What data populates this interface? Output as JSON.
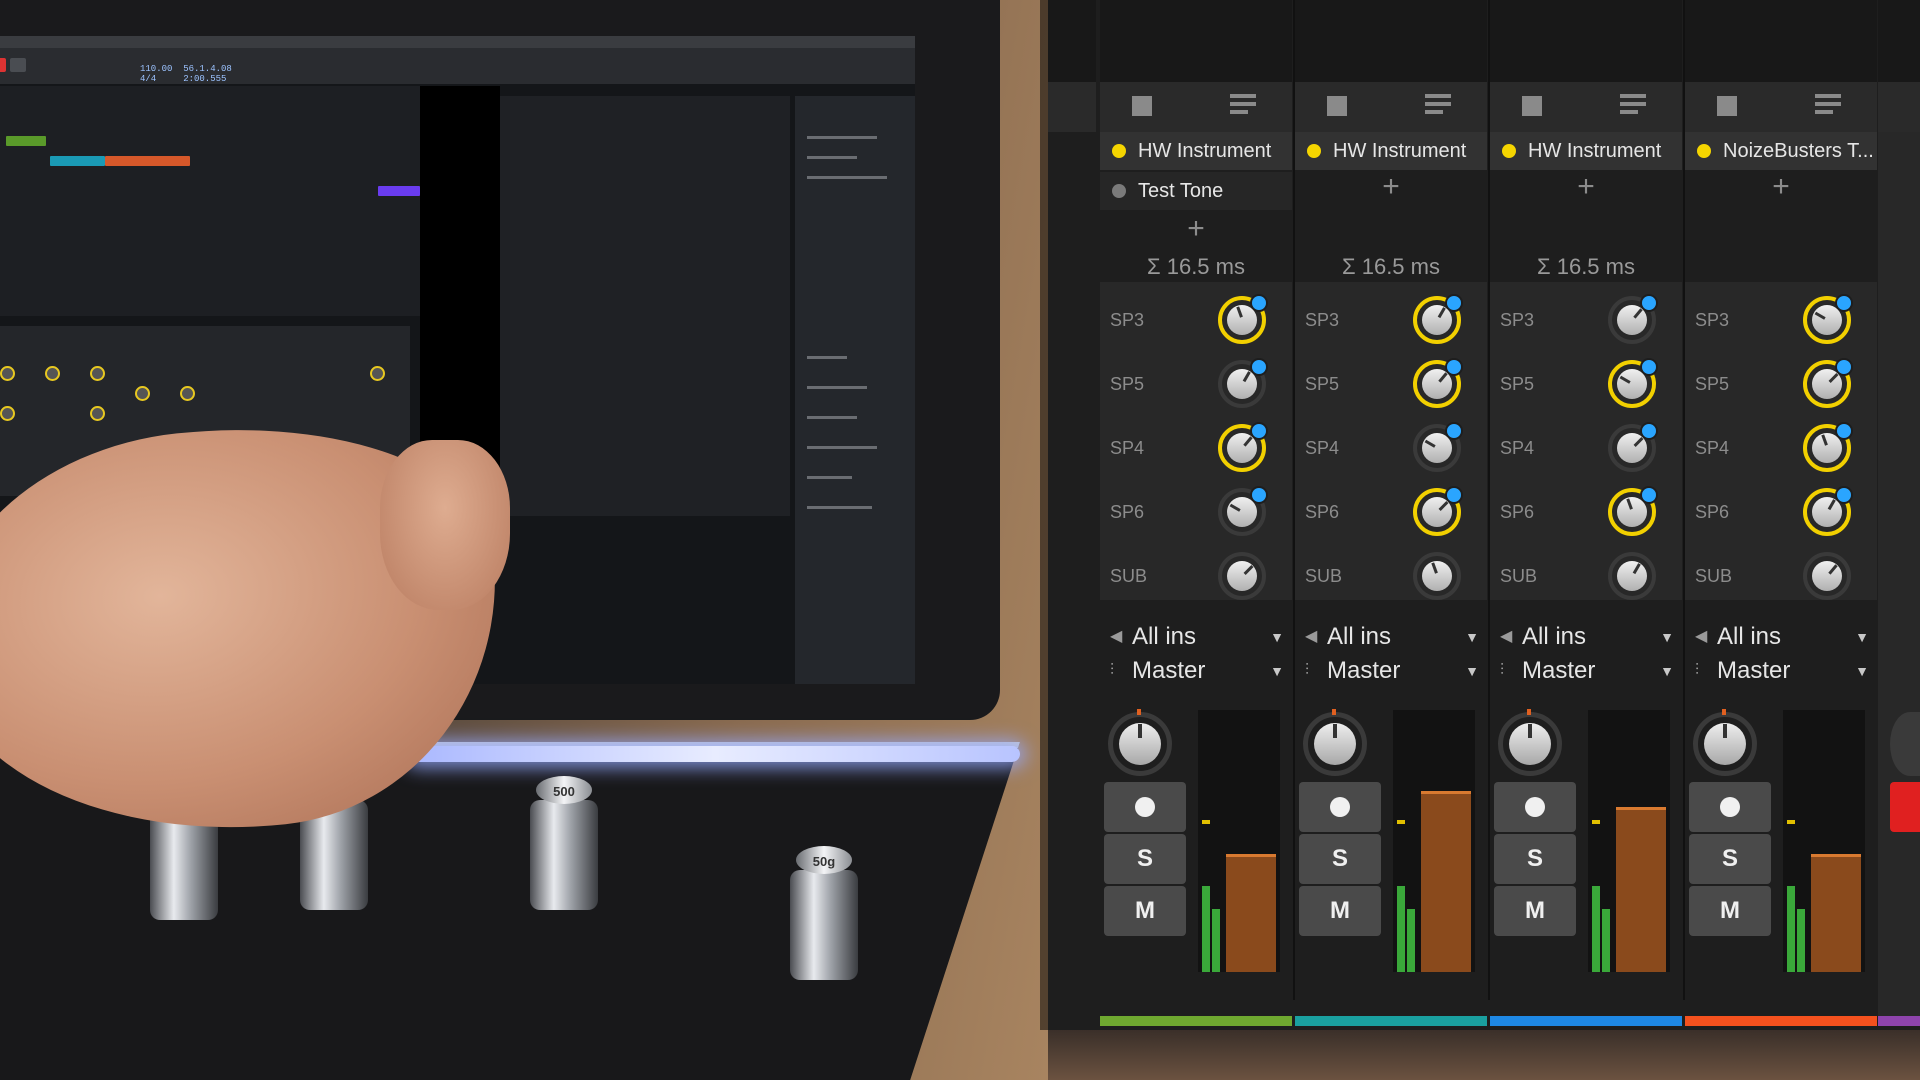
{
  "daw": {
    "clock_text": "110.00  56.1.4.08\n4/4     2:00.555"
  },
  "weights": {
    "left_label": "",
    "mid_label": "500",
    "right_label": "50g"
  },
  "colors": {
    "accent_yellow": "#f5d500",
    "send_dot_blue": "#2aa5ff",
    "meter_green": "#3aa83a",
    "meter_fill_orange": "#8a4a1c",
    "record_red": "#e02020"
  },
  "channels": [
    {
      "instrument": "HW Instrument",
      "extra_device": "Test Tone",
      "latency": "Σ 16.5 ms",
      "sends": [
        {
          "label": "SP3",
          "active": true,
          "indicator": true
        },
        {
          "label": "SP5",
          "active": false,
          "indicator": true
        },
        {
          "label": "SP4",
          "active": true,
          "indicator": true
        },
        {
          "label": "SP6",
          "active": false,
          "indicator": true
        },
        {
          "label": "SUB",
          "active": false,
          "indicator": false
        }
      ],
      "input": "All ins",
      "output": "Master",
      "solo_label": "S",
      "mute_label": "M",
      "meter_level": 0.44,
      "color": "#6fa830"
    },
    {
      "instrument": "HW Instrument",
      "extra_device": "",
      "latency": "Σ 16.5 ms",
      "sends": [
        {
          "label": "SP3",
          "active": true,
          "indicator": true
        },
        {
          "label": "SP5",
          "active": true,
          "indicator": true
        },
        {
          "label": "SP4",
          "active": false,
          "indicator": true
        },
        {
          "label": "SP6",
          "active": true,
          "indicator": true
        },
        {
          "label": "SUB",
          "active": false,
          "indicator": false
        }
      ],
      "input": "All ins",
      "output": "Master",
      "solo_label": "S",
      "mute_label": "M",
      "meter_level": 0.68,
      "color": "#1aa0a0"
    },
    {
      "instrument": "HW Instrument",
      "extra_device": "",
      "latency": "Σ 16.5 ms",
      "sends": [
        {
          "label": "SP3",
          "active": false,
          "indicator": true
        },
        {
          "label": "SP5",
          "active": true,
          "indicator": true
        },
        {
          "label": "SP4",
          "active": false,
          "indicator": true
        },
        {
          "label": "SP6",
          "active": true,
          "indicator": true
        },
        {
          "label": "SUB",
          "active": false,
          "indicator": false
        }
      ],
      "input": "All ins",
      "output": "Master",
      "solo_label": "S",
      "mute_label": "M",
      "meter_level": 0.62,
      "color": "#1e88e5"
    },
    {
      "instrument": "NoizeBusters T...",
      "extra_device": "",
      "latency": "",
      "sends": [
        {
          "label": "SP3",
          "active": true,
          "indicator": true
        },
        {
          "label": "SP5",
          "active": true,
          "indicator": true
        },
        {
          "label": "SP4",
          "active": true,
          "indicator": true
        },
        {
          "label": "SP6",
          "active": true,
          "indicator": true
        },
        {
          "label": "SUB",
          "active": false,
          "indicator": false
        }
      ],
      "input": "All ins",
      "output": "Master",
      "solo_label": "S",
      "mute_label": "M",
      "meter_level": 0.44,
      "color": "#f4511e"
    }
  ]
}
